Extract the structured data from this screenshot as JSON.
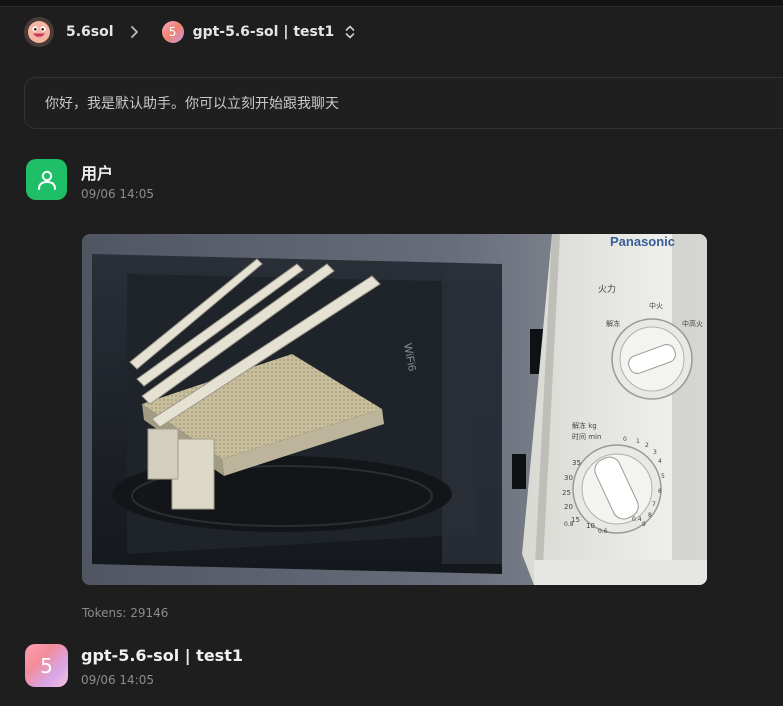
{
  "header": {
    "user_name": "5.6sol",
    "model_badge_glyph": "5",
    "model_label": "gpt-5.6-sol | test1"
  },
  "greeting": "你好，我是默认助手。你可以立刻开始跟我聊天",
  "messages": [
    {
      "role": "user",
      "name": "用户",
      "time": "09/06 14:05",
      "image": {
        "brand": "Panasonic",
        "heat_label": "火力",
        "knob_labels": [
          "中火",
          "解冻",
          "中高火",
          "低火"
        ],
        "timer_label": "解冻 kg",
        "time_label": "时间 min",
        "tick_labels": [
          "35",
          "30",
          "25",
          "20",
          "15",
          "10",
          "0.8",
          "0.6",
          "0.4"
        ],
        "small_marks": [
          "0",
          "1",
          "2",
          "3",
          "4",
          "5",
          "6",
          "7",
          "8",
          "9"
        ],
        "router_text": "WiFi6"
      },
      "tokens": "Tokens: 29146"
    },
    {
      "role": "assistant",
      "badge_glyph": "5",
      "name": "gpt-5.6-sol | test1",
      "time": "09/06 14:05"
    }
  ],
  "colors": {
    "background": "#1e1e1e",
    "user_avatar": "#1fbf68",
    "model_gradient": [
      "#ff9fb5",
      "#d8a6e8"
    ]
  },
  "icons": [
    "emoji-avatar-icon",
    "chevron-right-icon",
    "updown-chevron-icon",
    "user-icon"
  ]
}
